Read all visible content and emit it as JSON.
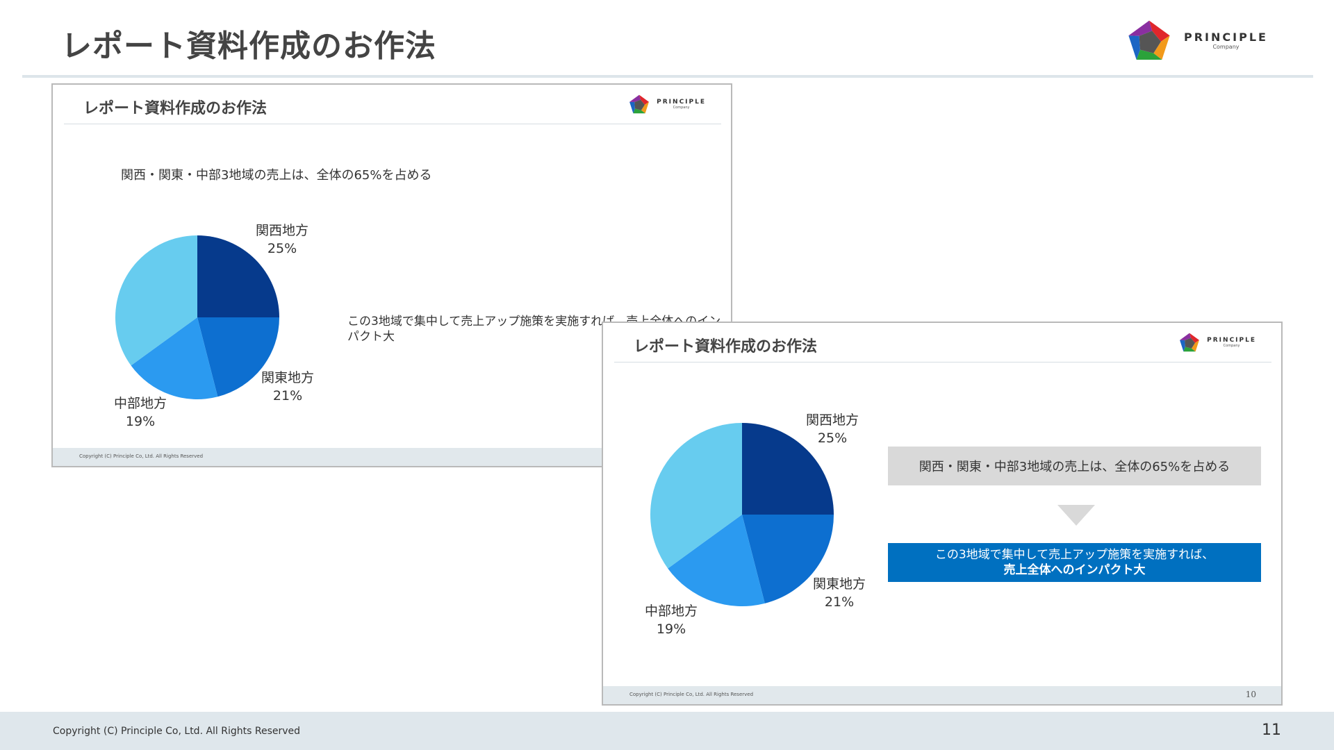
{
  "header": {
    "title": "レポート資料作成のお作法",
    "logo_text": "PRINCIPLE",
    "logo_sub": "Company"
  },
  "colors": {
    "accent_blue": "#0070c0",
    "navy": "#063a8c",
    "pie": [
      "#063a8c",
      "#0d6fd0",
      "#2b9af0",
      "#67ccef"
    ],
    "footer_bg": "#dfe7ec"
  },
  "slide_a": {
    "title": "レポート資料作成のお作法",
    "headline": "関西・関東・中部3地域の売上は、全体の65%を占める",
    "body": "この3地域で集中して売上アップ施策を実施すれば、売上全体へのインパクト大",
    "copyright": "Copyright (C) Principle Co, Ltd. All Rights Reserved"
  },
  "slide_b": {
    "title": "レポート資料作成のお作法",
    "grey_box": "関西・関東・中部3地域の売上は、全体の65%を占める",
    "blue_line1": "この3地域で集中して売上アップ施策を実施すれば、",
    "blue_line2": "売上全体へのインパクト大",
    "copyright": "Copyright (C) Principle Co, Ltd. All Rights Reserved",
    "page": "10"
  },
  "chart_data": {
    "type": "pie",
    "slices": [
      {
        "name": "関西地方",
        "label": "25%",
        "value": 25
      },
      {
        "name": "関東地方",
        "label": "21%",
        "value": 21
      },
      {
        "name": "中部地方",
        "label": "19%",
        "value": 19
      },
      {
        "name": "",
        "label": "",
        "value": 35
      }
    ]
  },
  "footer": {
    "copyright": "Copyright (C) Principle Co, Ltd. All Rights Reserved",
    "page": "11"
  }
}
